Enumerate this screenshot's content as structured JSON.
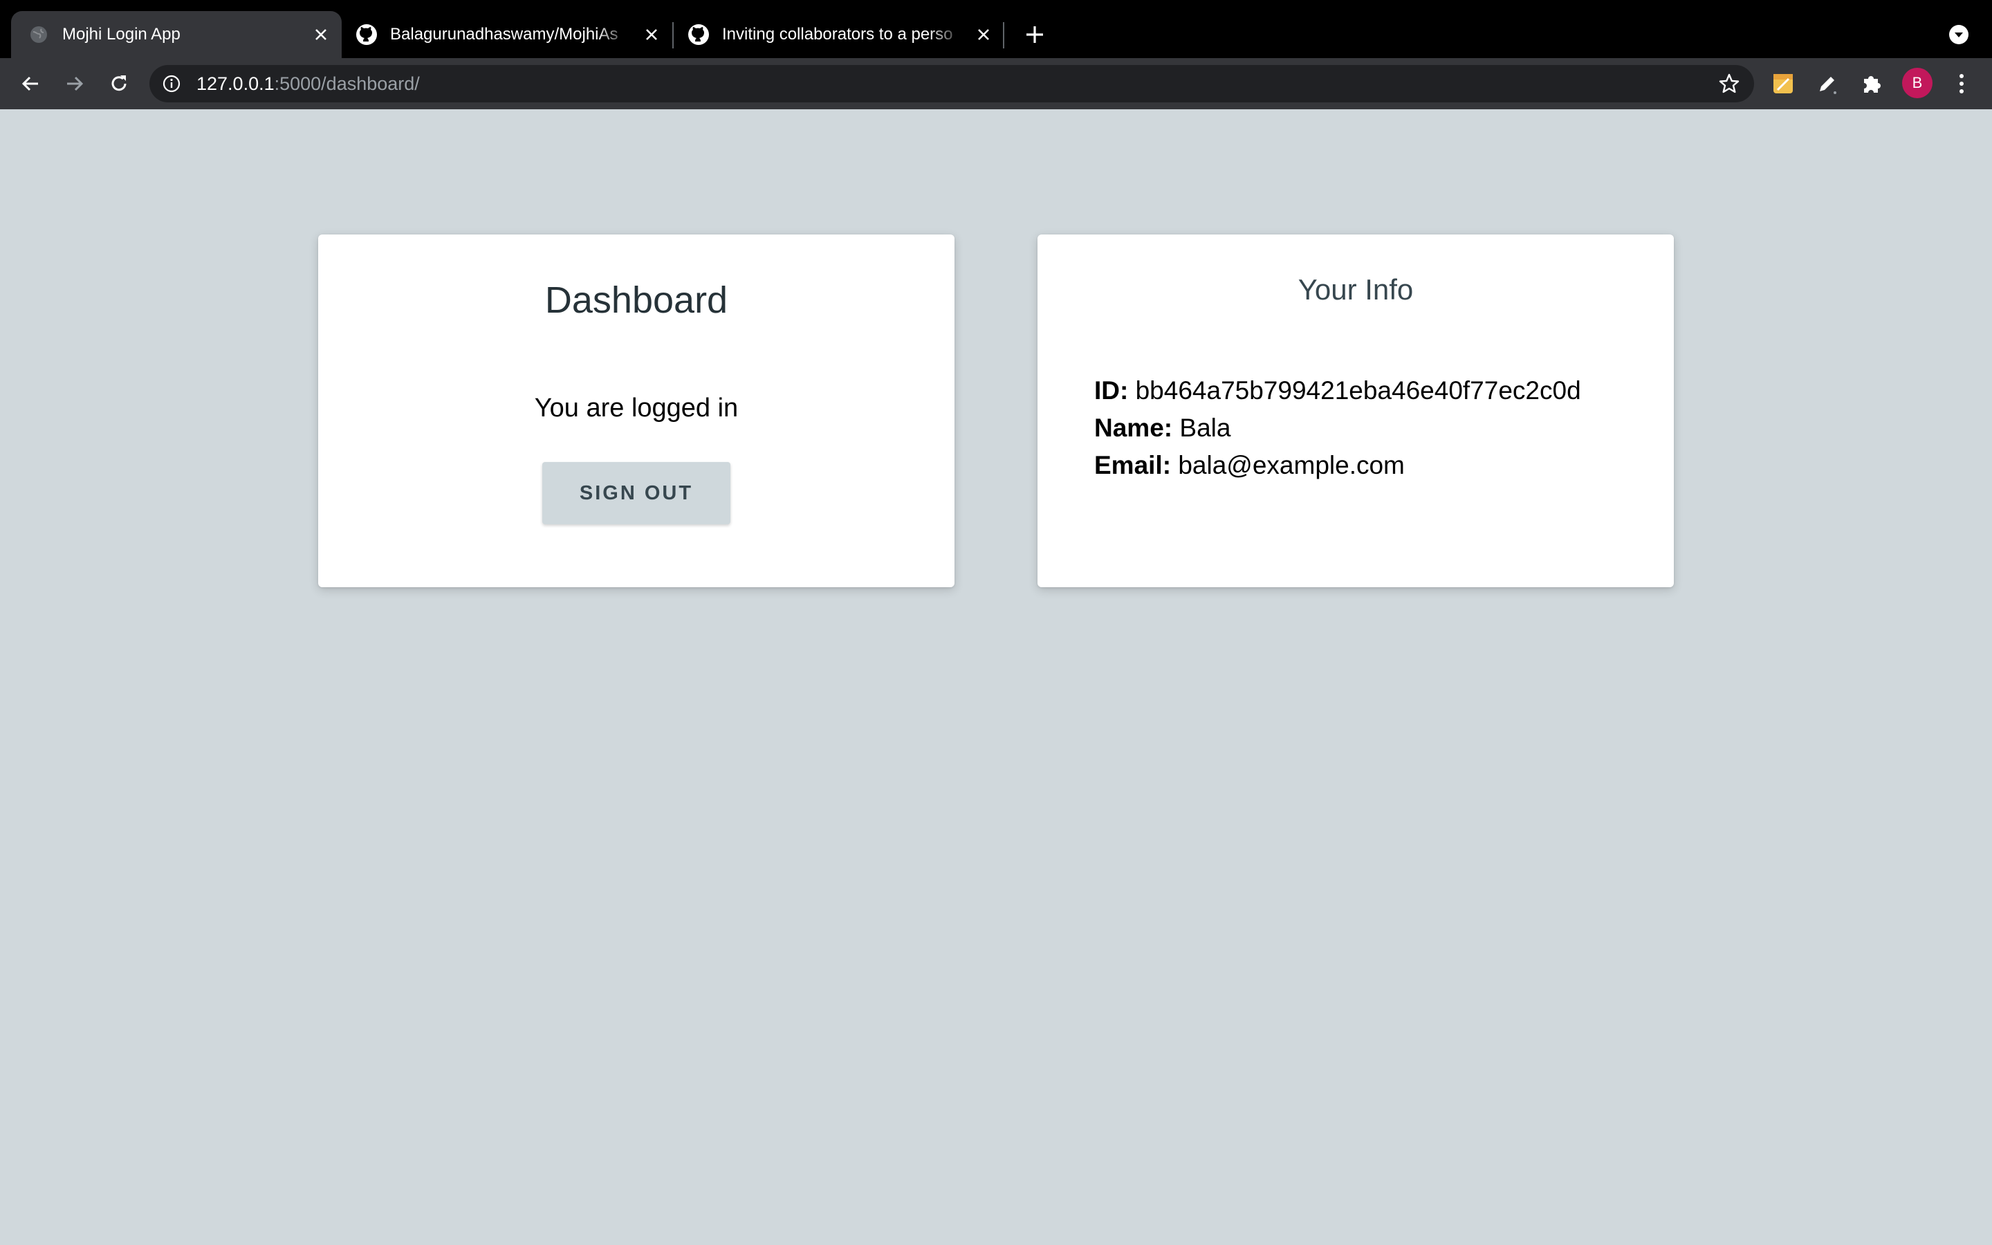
{
  "browser": {
    "tabs": [
      {
        "title": "Mojhi Login App",
        "icon": "globe-icon",
        "active": true
      },
      {
        "title": "Balagurunadhaswamy/MojhiAs",
        "icon": "github-icon",
        "active": false
      },
      {
        "title": "Inviting collaborators to a perso",
        "icon": "github-icon",
        "active": false
      }
    ],
    "url": {
      "host": "127.0.0.1",
      "path": ":5000/dashboard/"
    },
    "profile_initial": "B",
    "colors": {
      "tabstrip": "#000000",
      "toolbar": "#35363a",
      "omnibox": "#202124",
      "avatar": "#c2185b"
    }
  },
  "dashboard": {
    "title": "Dashboard",
    "status_text": "You are logged in",
    "signout_label": "SIGN OUT"
  },
  "info": {
    "title": "Your Info",
    "id_label": "ID:",
    "id_value": "bb464a75b799421eba46e40f77ec2c0d",
    "name_label": "Name:",
    "name_value": "Bala",
    "email_label": "Email:",
    "email_value": "bala@example.com"
  },
  "page": {
    "background": "#d0d8dc",
    "card_background": "#ffffff",
    "button_background": "#cfd8dc"
  }
}
